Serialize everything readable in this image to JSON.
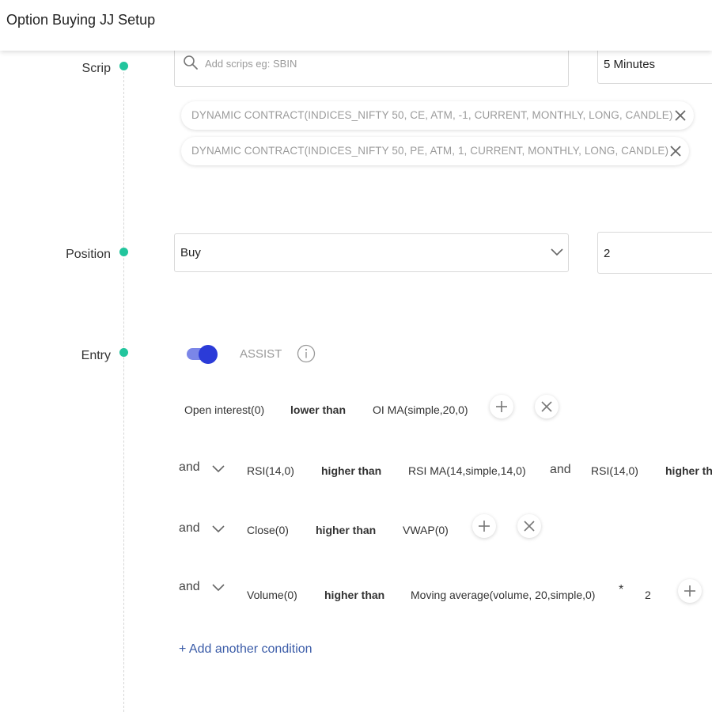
{
  "header": {
    "title": "Option Buying JJ Setup"
  },
  "sections": {
    "scrip": "Scrip",
    "position": "Position",
    "entry": "Entry"
  },
  "scrip": {
    "search_placeholder": "Add scrips eg: SBIN",
    "timeframe": "5 Minutes",
    "contracts": [
      "DYNAMIC CONTRACT(INDICES_NIFTY 50, CE, ATM, -1, CURRENT, MONTHLY, LONG, CANDLE)",
      "DYNAMIC CONTRACT(INDICES_NIFTY 50, PE, ATM, 1, CURRENT, MONTHLY, LONG, CANDLE)"
    ]
  },
  "position": {
    "side": "Buy",
    "quantity": "2"
  },
  "entry": {
    "assist_label": "ASSIST",
    "assist_on": true,
    "conditions": [
      {
        "left": "Open interest(0)",
        "op": "lower than",
        "right": "OI MA(simple,20,0)"
      },
      {
        "join": "and",
        "left": "RSI(14,0)",
        "op": "higher than",
        "right": "RSI MA(14,simple,14,0)",
        "and2": "and",
        "left2": "RSI(14,0)",
        "op2": "higher tha"
      },
      {
        "join": "and",
        "left": "Close(0)",
        "op": "higher than",
        "right": "VWAP(0)"
      },
      {
        "join": "and",
        "left": "Volume(0)",
        "op": "higher than",
        "right": "Moving average(volume, 20,simple,0)",
        "mult_symbol": "*",
        "mult_value": "2"
      }
    ],
    "add_condition": "+ Add another condition"
  },
  "colors": {
    "accent_dot": "#22c59d",
    "toggle": "#2b3bd8",
    "link": "#3b5ca8"
  }
}
